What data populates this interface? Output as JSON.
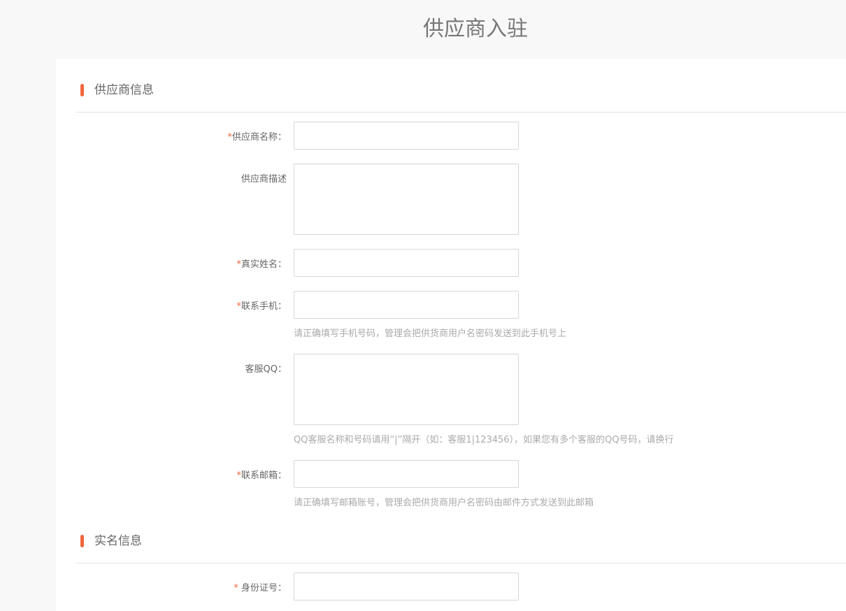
{
  "page": {
    "title": "供应商入驻"
  },
  "sections": [
    {
      "title": "供应商信息"
    },
    {
      "title": "实名信息"
    }
  ],
  "fields": {
    "supplier_name": {
      "required": "*",
      "label": "供应商名称：",
      "value": ""
    },
    "supplier_desc": {
      "required": "",
      "label": "供应商描述",
      "value": ""
    },
    "real_name": {
      "required": "*",
      "label": "真实姓名：",
      "value": ""
    },
    "mobile": {
      "required": "*",
      "label": "联系手机：",
      "value": "",
      "hint": "请正确填写手机号码，管理会把供货商用户名密码发送到此手机号上"
    },
    "service_qq": {
      "required": "",
      "label": "客服QQ：",
      "value": "",
      "hint": "QQ客服名称和号码请用“|”隔开（如：客服1|123456），如果您有多个客服的QQ号码，请换行"
    },
    "email": {
      "required": "*",
      "label": "联系邮箱：",
      "value": "",
      "hint": "请正确填写邮箱账号，管理会把供货商用户名密码由邮件方式发送到此邮箱"
    },
    "id_number": {
      "required": "*",
      "label": " 身份证号：",
      "value": ""
    }
  },
  "colors": {
    "accent": "#f0663c",
    "page_bg": "#f8f8f8",
    "panel_bg": "#ffffff"
  }
}
